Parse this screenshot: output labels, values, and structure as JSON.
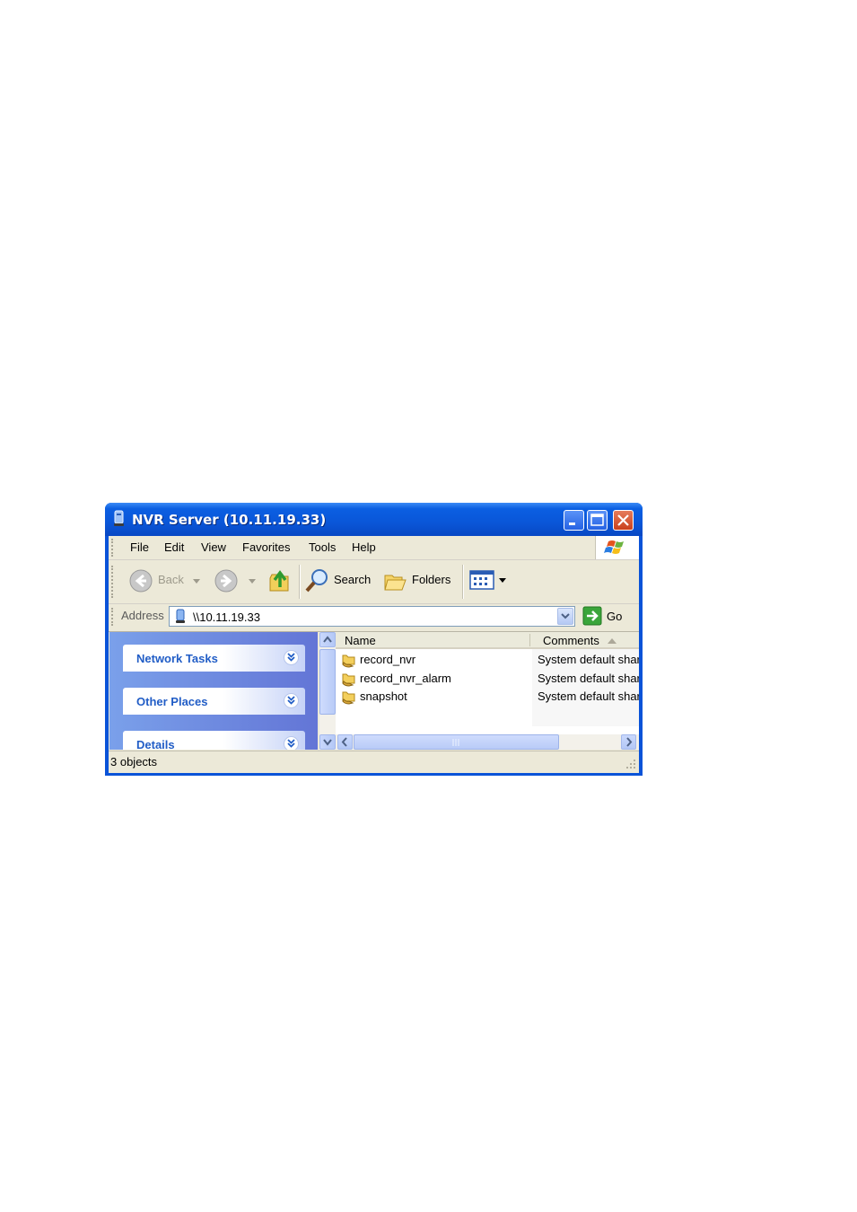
{
  "window": {
    "title": "NVR Server (10.11.19.33)"
  },
  "menubar": {
    "items": [
      "File",
      "Edit",
      "View",
      "Favorites",
      "Tools",
      "Help"
    ]
  },
  "toolbar": {
    "back_label": "Back",
    "search_label": "Search",
    "folders_label": "Folders"
  },
  "addressbar": {
    "label": "Address",
    "value": "\\\\10.11.19.33",
    "go_label": "Go"
  },
  "taskpane": {
    "sections": [
      "Network Tasks",
      "Other Places",
      "Details"
    ]
  },
  "filelist": {
    "columns": [
      "Name",
      "Comments"
    ],
    "rows": [
      {
        "name": "record_nvr",
        "comment": "System default shar"
      },
      {
        "name": "record_nvr_alarm",
        "comment": "System default shar"
      },
      {
        "name": "snapshot",
        "comment": "System default shar"
      }
    ]
  },
  "statusbar": {
    "text": "3 objects"
  },
  "colors": {
    "titlebar": "#0a56d8",
    "taskpane": "#6f8ee0",
    "task_header_text": "#215dc6",
    "chrome": "#ece9d8"
  }
}
